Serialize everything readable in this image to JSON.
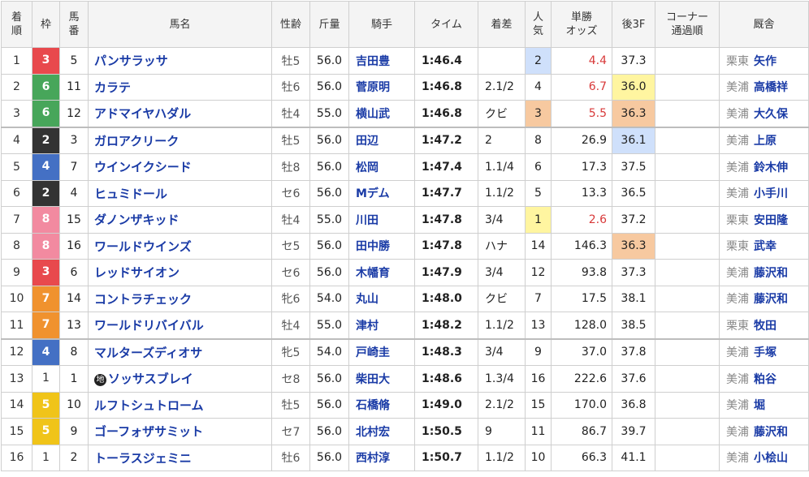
{
  "headers": {
    "rank": [
      "着",
      "順"
    ],
    "waku": "枠",
    "num": [
      "馬",
      "番"
    ],
    "name": "馬名",
    "sex_age": "性齢",
    "weight": "斤量",
    "jockey": "騎手",
    "time": "タイム",
    "margin": "着差",
    "pop": [
      "人",
      "気"
    ],
    "odds": [
      "単勝",
      "オッズ"
    ],
    "l3f": "後3F",
    "corner": [
      "コーナー",
      "通過順"
    ],
    "trainer": "厩舎"
  },
  "colors": {
    "waku_1": "#ffffff",
    "waku_2": "#333333",
    "waku_3": "#e8494d",
    "waku_4": "#4470c4",
    "waku_5": "#f0c419",
    "waku_6": "#47a65a",
    "waku_7": "#f0922e",
    "waku_8": "#f28aa0",
    "highlight_blue": "#cfe0fb",
    "highlight_orange": "#f7c9a0",
    "highlight_yellow": "#fff5a0",
    "odds_hot": "#d83a3a",
    "link": "#1a3ba6"
  },
  "rows": [
    {
      "rank": "1",
      "waku": "3",
      "num": "5",
      "name": "パンサラッサ",
      "chi": "",
      "sex": "牡5",
      "weight": "56.0",
      "jockey": "吉田豊",
      "time": "1:46.4",
      "margin": "",
      "pop": "2",
      "odds": "4.4",
      "l3f": "37.3",
      "corner": "",
      "area": "栗東",
      "trainer": "矢作",
      "pop_hl": "blue",
      "l3f_hl": "",
      "odds_hot": true
    },
    {
      "rank": "2",
      "waku": "6",
      "num": "11",
      "name": "カラテ",
      "chi": "",
      "sex": "牡6",
      "weight": "56.0",
      "jockey": "菅原明",
      "time": "1:46.8",
      "margin": "2.1/2",
      "pop": "4",
      "odds": "6.7",
      "l3f": "36.0",
      "corner": "",
      "area": "美浦",
      "trainer": "高橋祥",
      "pop_hl": "",
      "l3f_hl": "yellow",
      "odds_hot": true
    },
    {
      "rank": "3",
      "waku": "6",
      "num": "12",
      "name": "アドマイヤハダル",
      "chi": "",
      "sex": "牡4",
      "weight": "55.0",
      "jockey": "横山武",
      "time": "1:46.8",
      "margin": "クビ",
      "pop": "3",
      "odds": "5.5",
      "l3f": "36.3",
      "corner": "",
      "area": "美浦",
      "trainer": "大久保",
      "pop_hl": "orange",
      "l3f_hl": "orange",
      "odds_hot": true
    },
    {
      "rank": "4",
      "waku": "2",
      "num": "3",
      "name": "ガロアクリーク",
      "chi": "",
      "sex": "牡5",
      "weight": "56.0",
      "jockey": "田辺",
      "time": "1:47.2",
      "margin": "2",
      "pop": "8",
      "odds": "26.9",
      "l3f": "36.1",
      "corner": "",
      "area": "美浦",
      "trainer": "上原",
      "pop_hl": "",
      "l3f_hl": "blue",
      "odds_hot": false
    },
    {
      "rank": "5",
      "waku": "4",
      "num": "7",
      "name": "ウインイクシード",
      "chi": "",
      "sex": "牡8",
      "weight": "56.0",
      "jockey": "松岡",
      "time": "1:47.4",
      "margin": "1.1/4",
      "pop": "6",
      "odds": "17.3",
      "l3f": "37.5",
      "corner": "",
      "area": "美浦",
      "trainer": "鈴木伸",
      "pop_hl": "",
      "l3f_hl": "",
      "odds_hot": false
    },
    {
      "rank": "6",
      "waku": "2",
      "num": "4",
      "name": "ヒュミドール",
      "chi": "",
      "sex": "セ6",
      "weight": "56.0",
      "jockey": "Mデム",
      "time": "1:47.7",
      "margin": "1.1/2",
      "pop": "5",
      "odds": "13.3",
      "l3f": "36.5",
      "corner": "",
      "area": "美浦",
      "trainer": "小手川",
      "pop_hl": "",
      "l3f_hl": "",
      "odds_hot": false
    },
    {
      "rank": "7",
      "waku": "8",
      "num": "15",
      "name": "ダノンザキッド",
      "chi": "",
      "sex": "牡4",
      "weight": "55.0",
      "jockey": "川田",
      "time": "1:47.8",
      "margin": "3/4",
      "pop": "1",
      "odds": "2.6",
      "l3f": "37.2",
      "corner": "",
      "area": "栗東",
      "trainer": "安田隆",
      "pop_hl": "yellow",
      "l3f_hl": "",
      "odds_hot": true
    },
    {
      "rank": "8",
      "waku": "8",
      "num": "16",
      "name": "ワールドウインズ",
      "chi": "",
      "sex": "セ5",
      "weight": "56.0",
      "jockey": "田中勝",
      "time": "1:47.8",
      "margin": "ハナ",
      "pop": "14",
      "odds": "146.3",
      "l3f": "36.3",
      "corner": "",
      "area": "栗東",
      "trainer": "武幸",
      "pop_hl": "",
      "l3f_hl": "orange",
      "odds_hot": false
    },
    {
      "rank": "9",
      "waku": "3",
      "num": "6",
      "name": "レッドサイオン",
      "chi": "",
      "sex": "セ6",
      "weight": "56.0",
      "jockey": "木幡育",
      "time": "1:47.9",
      "margin": "3/4",
      "pop": "12",
      "odds": "93.8",
      "l3f": "37.3",
      "corner": "",
      "area": "美浦",
      "trainer": "藤沢和",
      "pop_hl": "",
      "l3f_hl": "",
      "odds_hot": false
    },
    {
      "rank": "10",
      "waku": "7",
      "num": "14",
      "name": "コントラチェック",
      "chi": "",
      "sex": "牝6",
      "weight": "54.0",
      "jockey": "丸山",
      "time": "1:48.0",
      "margin": "クビ",
      "pop": "7",
      "odds": "17.5",
      "l3f": "38.1",
      "corner": "",
      "area": "美浦",
      "trainer": "藤沢和",
      "pop_hl": "",
      "l3f_hl": "",
      "odds_hot": false
    },
    {
      "rank": "11",
      "waku": "7",
      "num": "13",
      "name": "ワールドリバイバル",
      "chi": "",
      "sex": "牡4",
      "weight": "55.0",
      "jockey": "津村",
      "time": "1:48.2",
      "margin": "1.1/2",
      "pop": "13",
      "odds": "128.0",
      "l3f": "38.5",
      "corner": "",
      "area": "栗東",
      "trainer": "牧田",
      "pop_hl": "",
      "l3f_hl": "",
      "odds_hot": false
    },
    {
      "rank": "12",
      "waku": "4",
      "num": "8",
      "name": "マルターズディオサ",
      "chi": "",
      "sex": "牝5",
      "weight": "54.0",
      "jockey": "戸崎圭",
      "time": "1:48.3",
      "margin": "3/4",
      "pop": "9",
      "odds": "37.0",
      "l3f": "37.8",
      "corner": "",
      "area": "美浦",
      "trainer": "手塚",
      "pop_hl": "",
      "l3f_hl": "",
      "odds_hot": false
    },
    {
      "rank": "13",
      "waku": "1",
      "num": "1",
      "name": "ソッサスブレイ",
      "chi": "地",
      "sex": "セ8",
      "weight": "56.0",
      "jockey": "柴田大",
      "time": "1:48.6",
      "margin": "1.3/4",
      "pop": "16",
      "odds": "222.6",
      "l3f": "37.6",
      "corner": "",
      "area": "美浦",
      "trainer": "粕谷",
      "pop_hl": "",
      "l3f_hl": "",
      "odds_hot": false
    },
    {
      "rank": "14",
      "waku": "5",
      "num": "10",
      "name": "ルフトシュトローム",
      "chi": "",
      "sex": "牡5",
      "weight": "56.0",
      "jockey": "石橋脩",
      "time": "1:49.0",
      "margin": "2.1/2",
      "pop": "15",
      "odds": "170.0",
      "l3f": "36.8",
      "corner": "",
      "area": "美浦",
      "trainer": "堀",
      "pop_hl": "",
      "l3f_hl": "",
      "odds_hot": false
    },
    {
      "rank": "15",
      "waku": "5",
      "num": "9",
      "name": "ゴーフォザサミット",
      "chi": "",
      "sex": "セ7",
      "weight": "56.0",
      "jockey": "北村宏",
      "time": "1:50.5",
      "margin": "9",
      "pop": "11",
      "odds": "86.7",
      "l3f": "39.7",
      "corner": "",
      "area": "美浦",
      "trainer": "藤沢和",
      "pop_hl": "",
      "l3f_hl": "",
      "odds_hot": false
    },
    {
      "rank": "16",
      "waku": "1",
      "num": "2",
      "name": "トーラスジェミニ",
      "chi": "",
      "sex": "牡6",
      "weight": "56.0",
      "jockey": "西村淳",
      "time": "1:50.7",
      "margin": "1.1/2",
      "pop": "10",
      "odds": "66.3",
      "l3f": "41.1",
      "corner": "",
      "area": "美浦",
      "trainer": "小桧山",
      "pop_hl": "",
      "l3f_hl": "",
      "odds_hot": false
    }
  ]
}
